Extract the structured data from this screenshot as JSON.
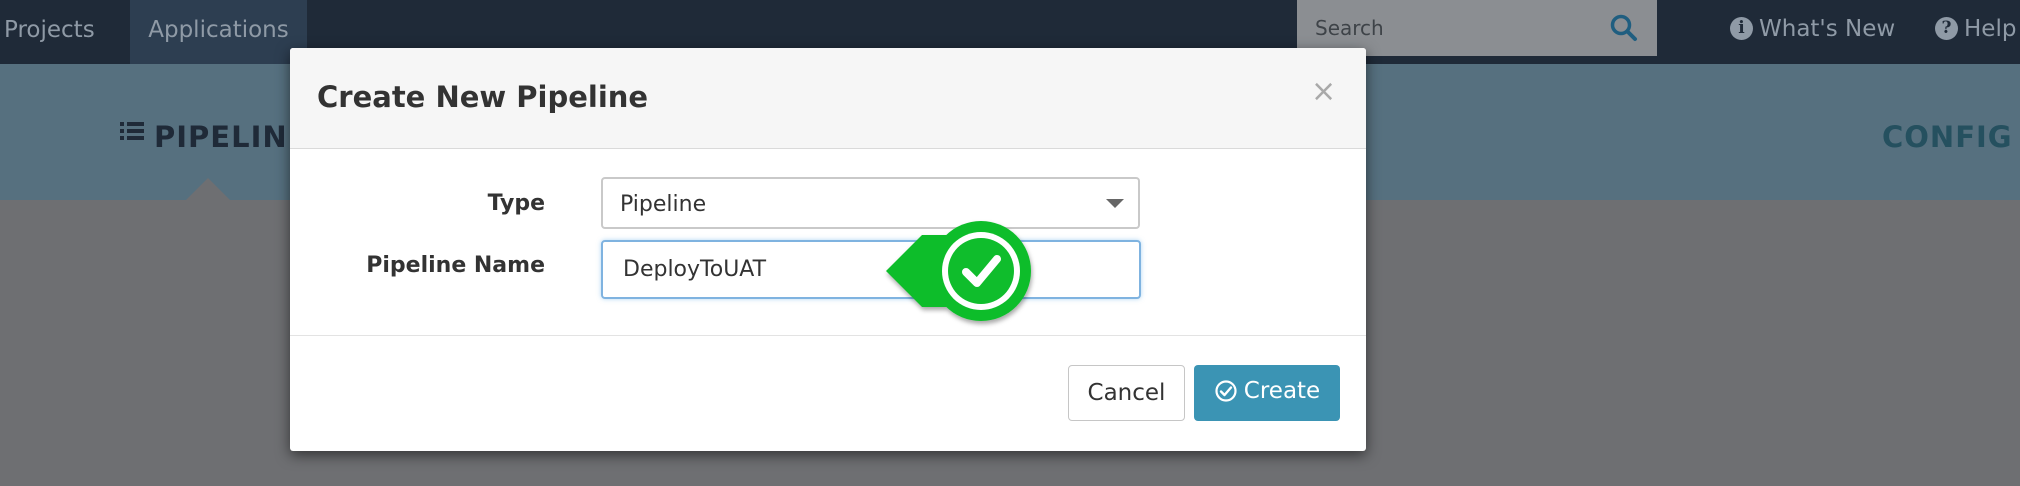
{
  "navbar": {
    "items": [
      {
        "label": "Projects"
      },
      {
        "label": "Applications"
      }
    ],
    "search": {
      "placeholder": "Search"
    },
    "whats_new": {
      "label": "What's New"
    },
    "help": {
      "label": "Help"
    }
  },
  "subheader": {
    "pipelines_tab": "PIPELINES",
    "config_tab": "CONFIG"
  },
  "modal": {
    "title": "Create New Pipeline",
    "close": "×",
    "type_label": "Type",
    "type_value": "Pipeline",
    "name_label": "Pipeline Name",
    "name_value": "DeployToUAT",
    "cancel": "Cancel",
    "create": "Create"
  },
  "colors": {
    "navbar": "#1f2a38",
    "accent": "#3b94b4",
    "callout_green": "#0ec02e"
  },
  "icons": {
    "search": "search-icon",
    "info": "info-circle-icon",
    "help": "question-circle-icon",
    "list": "list-icon",
    "create": "check-circle-icon",
    "callout": "checkmark-icon"
  }
}
